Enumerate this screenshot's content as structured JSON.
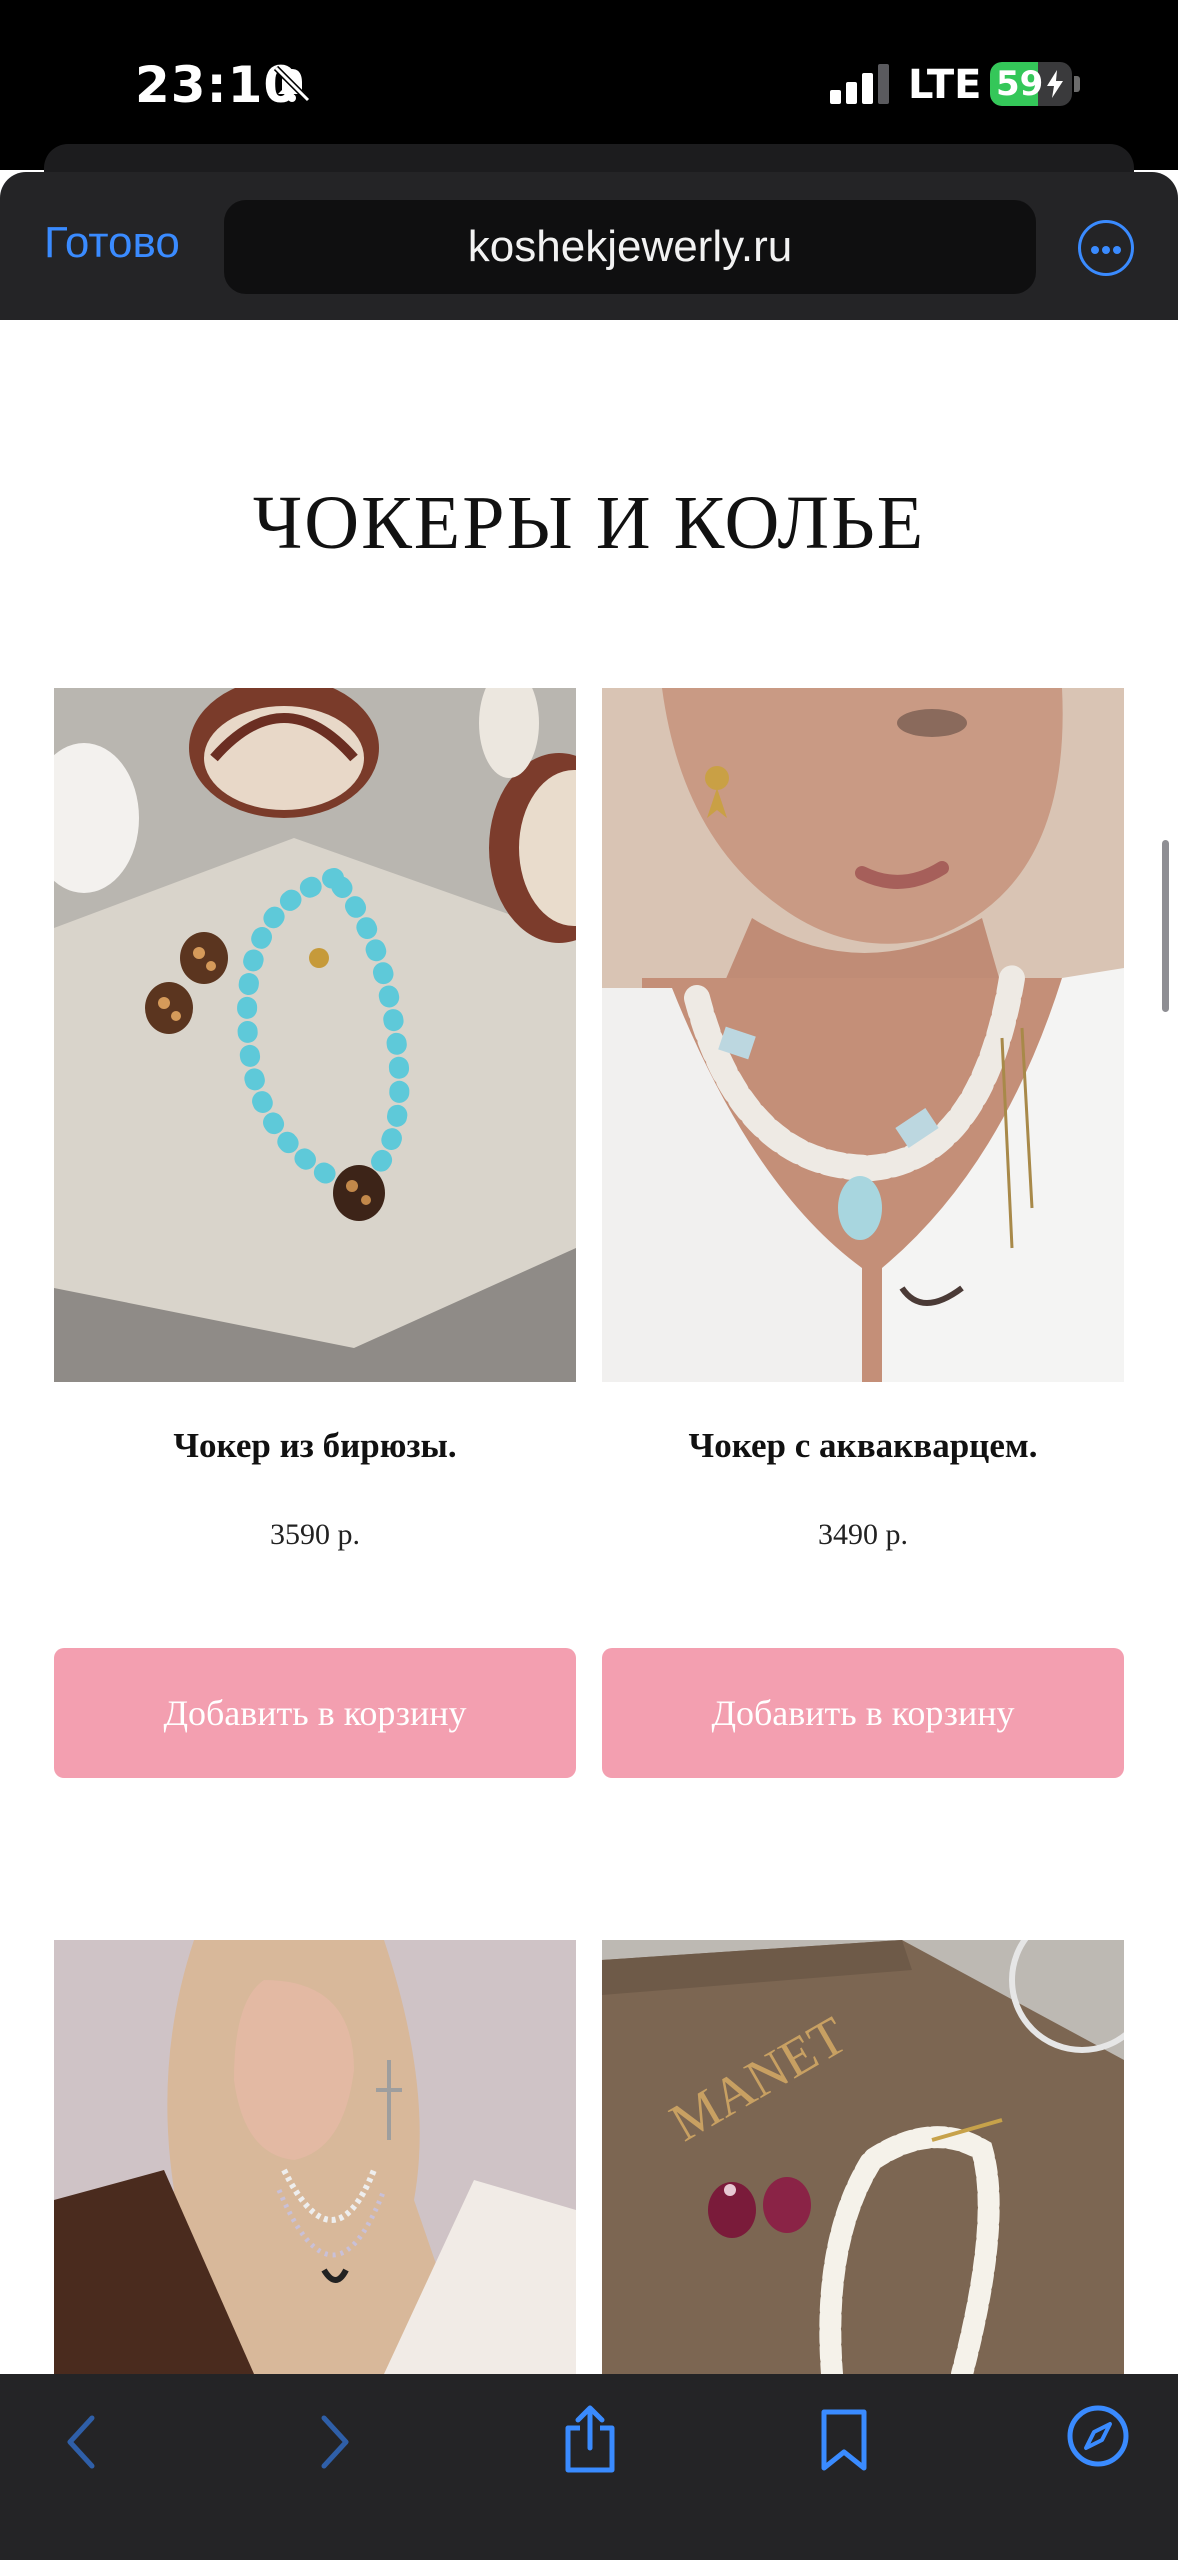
{
  "status_bar": {
    "time": "23:10",
    "network": "LTE",
    "battery_percent": "59",
    "battery_level": 0.59,
    "icons": [
      "bell-slash-icon",
      "cellular-signal-icon",
      "battery-charging-icon"
    ]
  },
  "browser": {
    "done_label": "Готово",
    "url": "koshekjewerly.ru",
    "accent_color": "#3a8bff"
  },
  "page": {
    "section_title": "ЧОКЕРЫ И КОЛЬЕ",
    "button_color": "#f39fb0",
    "products": [
      {
        "name": "Чокер из бирюзы.",
        "price": "3590 р.",
        "button_label": "Добавить в корзину"
      },
      {
        "name": "Чокер с аквакварцем.",
        "price": "3490 р.",
        "button_label": "Добавить в корзину"
      }
    ],
    "next_row_images": [
      "model-with-necklaces-photo",
      "pearl-necklace-on-manet-box-photo"
    ],
    "box_text": "MANET"
  },
  "toolbar": {
    "icons": [
      "back-icon",
      "forward-icon",
      "share-icon",
      "bookmarks-icon",
      "safari-compass-icon"
    ]
  }
}
